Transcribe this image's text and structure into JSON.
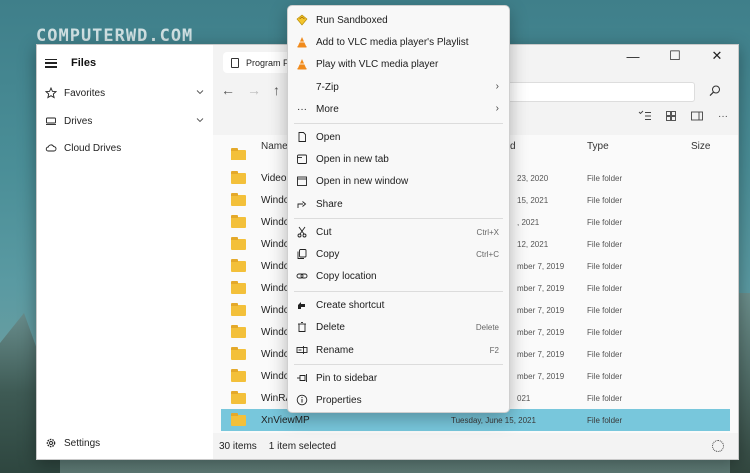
{
  "watermark": "COMPUTERWD.COM",
  "app": {
    "title": "Files",
    "tab_label": "Program F",
    "window_controls": {
      "minimize": "—",
      "maximize": "☐",
      "close": "✕"
    }
  },
  "sidebar": {
    "items": [
      {
        "label": "Favorites"
      },
      {
        "label": "Drives"
      },
      {
        "label": "Cloud Drives"
      }
    ],
    "settings_label": "Settings"
  },
  "nav": {
    "back": "←",
    "forward": "→",
    "up": "↑"
  },
  "columns": {
    "name": "Name",
    "date": "d",
    "type": "Type",
    "size": "Size"
  },
  "rows": [
    {
      "name": "",
      "date": "",
      "type": ""
    },
    {
      "name": "VideoL",
      "date": "23, 2020",
      "type": "File folder"
    },
    {
      "name": "Windo",
      "date": "15, 2021",
      "type": "File folder"
    },
    {
      "name": "Windo",
      "date": ", 2021",
      "type": "File folder"
    },
    {
      "name": "Windo",
      "date": "12, 2021",
      "type": "File folder"
    },
    {
      "name": "Windo",
      "date": "mber 7, 2019",
      "type": "File folder"
    },
    {
      "name": "Windo",
      "date": "mber 7, 2019",
      "type": "File folder"
    },
    {
      "name": "Windo",
      "date": "mber 7, 2019",
      "type": "File folder"
    },
    {
      "name": "Windo",
      "date": "mber 7, 2019",
      "type": "File folder"
    },
    {
      "name": "Windo",
      "date": "mber 7, 2019",
      "type": "File folder"
    },
    {
      "name": "Windo",
      "date": "mber 7, 2019",
      "type": "File folder"
    },
    {
      "name": "WinRA",
      "date": "021",
      "type": "File folder"
    },
    {
      "name": "XnViewMP",
      "date": "Tuesday, June 15, 2021",
      "type": "File folder"
    }
  ],
  "status": {
    "count": "30 items",
    "selection": "1 item selected"
  },
  "menu": {
    "items": [
      {
        "icon": "sandboxie-icon",
        "label": "Run Sandboxed",
        "shortcut": ""
      },
      {
        "icon": "vlc-icon",
        "label": "Add to VLC media player's Playlist",
        "shortcut": ""
      },
      {
        "icon": "vlc-icon",
        "label": "Play with VLC media player",
        "shortcut": ""
      },
      {
        "icon": "",
        "label": "7-Zip",
        "shortcut": ""
      },
      {
        "icon": "more-icon",
        "label": "More",
        "shortcut": ""
      },
      {
        "icon": "open-icon",
        "label": "Open",
        "shortcut": ""
      },
      {
        "icon": "new-tab-icon",
        "label": "Open in new tab",
        "shortcut": ""
      },
      {
        "icon": "new-window-icon",
        "label": "Open in new window",
        "shortcut": ""
      },
      {
        "icon": "share-icon",
        "label": "Share",
        "shortcut": ""
      },
      {
        "icon": "scissors-icon",
        "label": "Cut",
        "shortcut": "Ctrl+X"
      },
      {
        "icon": "copy-icon",
        "label": "Copy",
        "shortcut": "Ctrl+C"
      },
      {
        "icon": "link-icon",
        "label": "Copy location",
        "shortcut": ""
      },
      {
        "icon": "shortcut-icon",
        "label": "Create shortcut",
        "shortcut": ""
      },
      {
        "icon": "trash-icon",
        "label": "Delete",
        "shortcut": "Delete"
      },
      {
        "icon": "rename-icon",
        "label": "Rename",
        "shortcut": "F2"
      },
      {
        "icon": "pin-icon",
        "label": "Pin to sidebar",
        "shortcut": ""
      },
      {
        "icon": "info-icon",
        "label": "Properties",
        "shortcut": ""
      }
    ],
    "submenu_arrow": "›",
    "more_glyph": "···"
  },
  "colors": {
    "selected_row": "#78c7dc",
    "folder": "#f3c03a",
    "vlc": "#f08a1c"
  }
}
